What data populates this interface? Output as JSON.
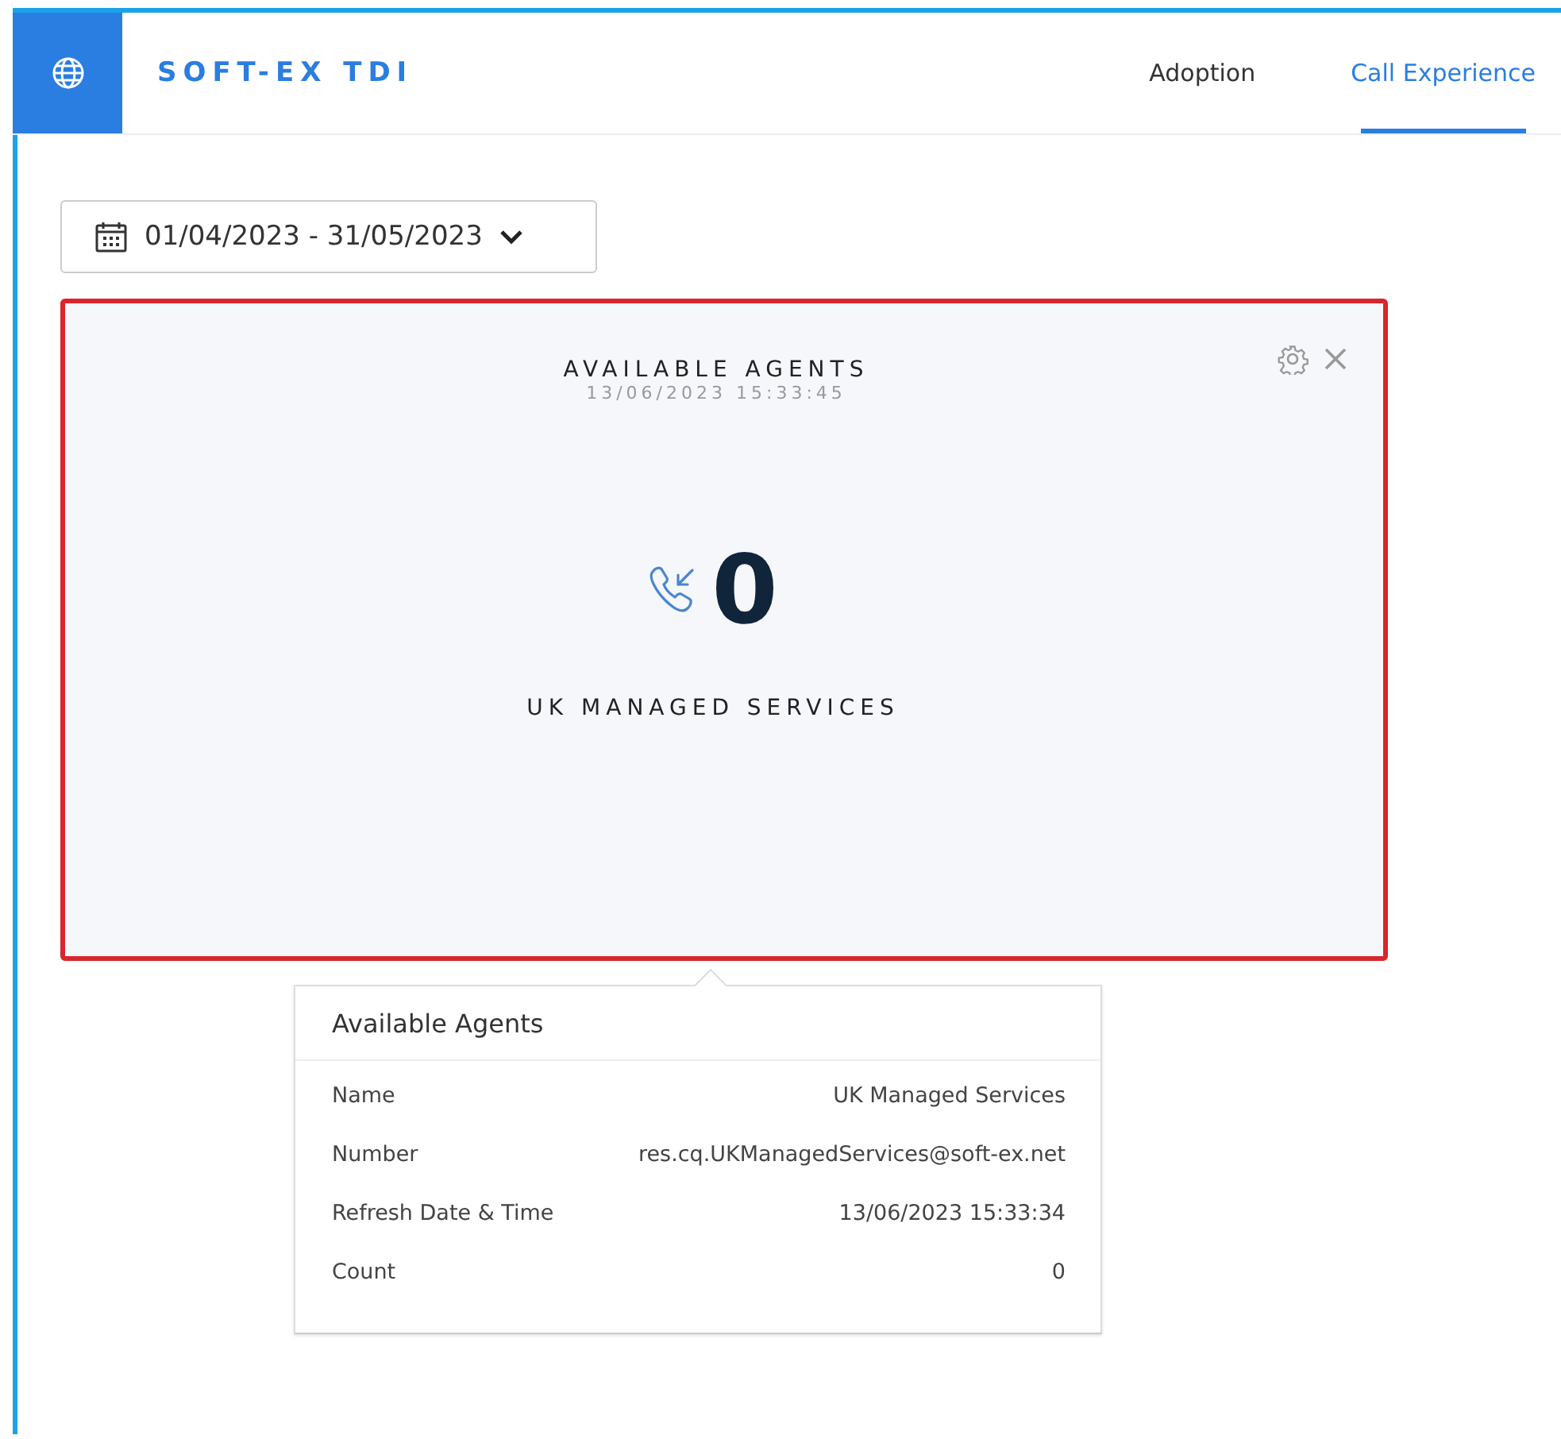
{
  "header": {
    "title": "SOFT-EX TDI"
  },
  "tabs": [
    {
      "label": "Adoption",
      "selected": false
    },
    {
      "label": "Call Experience",
      "selected": true
    }
  ],
  "date_range": {
    "value": "01/04/2023 - 31/05/2023"
  },
  "widget": {
    "title": "AVAILABLE AGENTS",
    "timestamp": "13/06/2023 15:33:45",
    "value": "0",
    "caption": "UK MANAGED SERVICES",
    "highlighted": true
  },
  "tooltip": {
    "title": "Available Agents",
    "rows": [
      {
        "label": "Name",
        "value": "UK Managed Services"
      },
      {
        "label": "Number",
        "value": "res.cq.UKManagedServices@soft-ex.net"
      },
      {
        "label": "Refresh Date & Time",
        "value": "13/06/2023 15:33:34"
      },
      {
        "label": "Count",
        "value": "0"
      }
    ]
  }
}
